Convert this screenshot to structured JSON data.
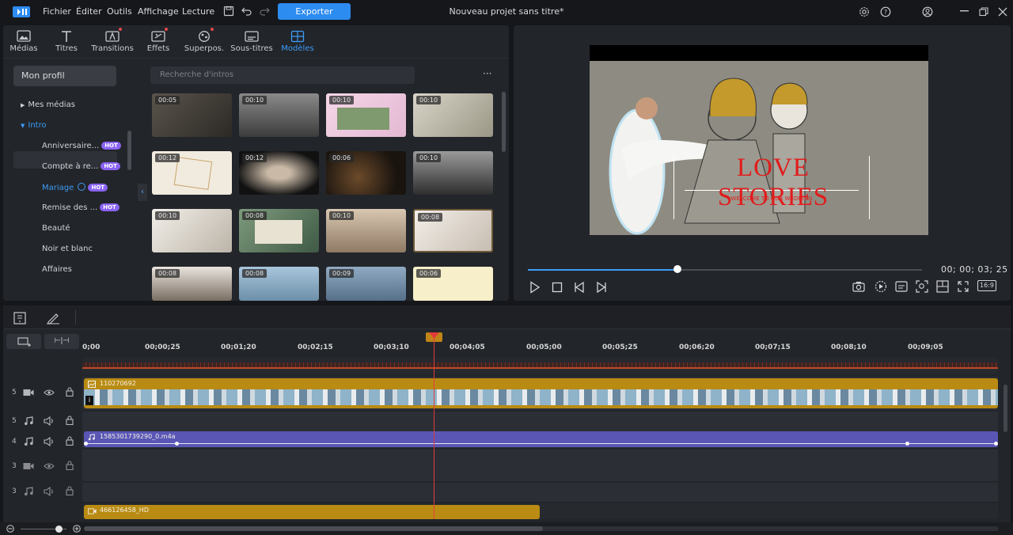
{
  "menu": {
    "items": [
      "Fichier",
      "Éditer",
      "Outils",
      "Affichage",
      "Lecture"
    ],
    "export_label": "Exporter",
    "project_title": "Nouveau projet sans titre*"
  },
  "library": {
    "tabs": [
      {
        "label": "Médias",
        "icon": "media-icon"
      },
      {
        "label": "Titres",
        "icon": "title-icon"
      },
      {
        "label": "Transitions",
        "icon": "transition-icon"
      },
      {
        "label": "Effets",
        "icon": "effects-icon"
      },
      {
        "label": "Superpos.",
        "icon": "overlay-icon"
      },
      {
        "label": "Sous-titres",
        "icon": "subtitles-icon"
      },
      {
        "label": "Modèles",
        "icon": "templates-icon"
      }
    ],
    "active_tab": "Modèles",
    "profile_label": "Mon profil",
    "sidebar": [
      {
        "label": "Mes médias",
        "type": "folder"
      },
      {
        "label": "Intro",
        "type": "folder-open"
      },
      {
        "label": "Anniversaire...",
        "hot": true
      },
      {
        "label": "Compte à re...",
        "hot": true
      },
      {
        "label": "Mariage",
        "hot": true,
        "selected": true
      },
      {
        "label": "Remise des ...",
        "hot": true
      },
      {
        "label": "Beauté"
      },
      {
        "label": "Noir et blanc"
      },
      {
        "label": "Affaires"
      }
    ],
    "hot_label": "HOT",
    "search_placeholder": "Recherche d'intros",
    "more_label": "···",
    "thumbnails": [
      {
        "duration": "00:05",
        "color": "#3d3a36"
      },
      {
        "duration": "00:10",
        "color": "#5a5a5a"
      },
      {
        "duration": "00:10",
        "color": "#e9c8dc"
      },
      {
        "duration": "00:10",
        "color": "#b8b5a6"
      },
      {
        "duration": "00:12",
        "color": "#ece6d6"
      },
      {
        "duration": "00:12",
        "color": "#1b1b1b"
      },
      {
        "duration": "00:06",
        "color": "#2d241c"
      },
      {
        "duration": "00:10",
        "color": "#6c6c6c"
      },
      {
        "duration": "00:10",
        "color": "#d9d5ce"
      },
      {
        "duration": "00:08",
        "color": "#56705a"
      },
      {
        "duration": "00:10",
        "color": "#b7a48f"
      },
      {
        "duration": "00:08",
        "color": "#e5dfd6"
      },
      {
        "duration": "00:08",
        "color": "#d6d0c9"
      },
      {
        "duration": "00:08",
        "color": "#8ab0c9"
      },
      {
        "duration": "00:09",
        "color": "#7f9ab4"
      },
      {
        "duration": "00:06",
        "color": "#f2eac4"
      }
    ]
  },
  "preview": {
    "title_text": "LOVE STORIES",
    "subtitle_text": "WELCOME TO OUR WEDDING",
    "timecode": "00; 00; 03; 25",
    "progress_fraction": 0.38,
    "aspect_label": "16:9"
  },
  "timeline": {
    "ruler_ticks": [
      "0;00",
      "00;00;25",
      "00;01;20",
      "00;02;15",
      "00;03;10",
      "00;04;05",
      "00;05;00",
      "00;05;25",
      "00;06;20",
      "00;07;15",
      "00;08;10",
      "00;09;05"
    ],
    "tracks": [
      {
        "number": "5",
        "kind": "video",
        "clip": "110270692"
      },
      {
        "number": "5",
        "kind": "audio",
        "clip": ""
      },
      {
        "number": "4",
        "kind": "audio",
        "clip": "1585301739290_0.m4a"
      },
      {
        "number": "3",
        "kind": "video",
        "clip": ""
      },
      {
        "number": "3",
        "kind": "audio",
        "clip": ""
      },
      {
        "number": "",
        "kind": "video",
        "clip": "466126458_HD"
      }
    ],
    "playhead_fraction": 0.382
  },
  "colors": {
    "accent": "#2d8cf0",
    "video_clip": "#b98b13",
    "audio_clip": "#5956b6",
    "playhead": "#e33a3a",
    "hot_badge": "#8a63f3"
  }
}
